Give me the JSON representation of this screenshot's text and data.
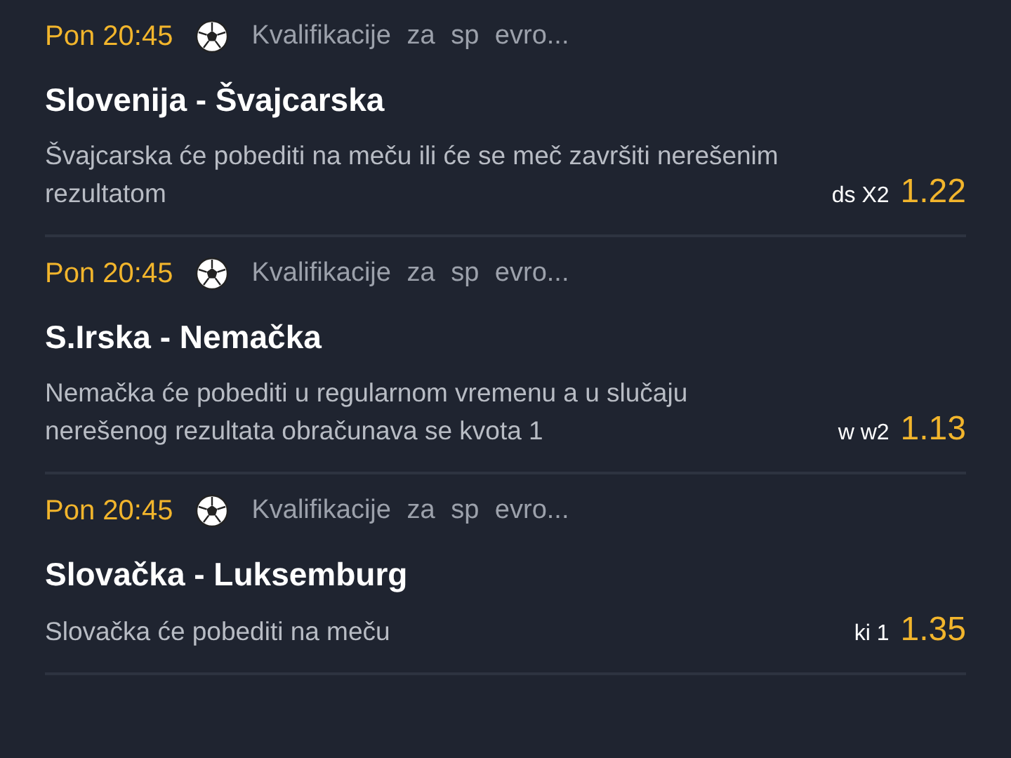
{
  "matches": [
    {
      "time": "Pon 20:45",
      "league": "Kvalifikacije za sp evro...",
      "teams": "Slovenija - Švajcarska",
      "description": "Švajcarska će pobediti na meču ili će se meč završiti nerešenim rezultatom",
      "bet": "ds X2",
      "odds": "1.22"
    },
    {
      "time": "Pon 20:45",
      "league": "Kvalifikacije za sp evro...",
      "teams": "S.Irska - Nemačka",
      "description": "Nemačka će pobediti u regularnom vremenu a u slučaju nerešenog rezultata obračunava se kvota 1",
      "bet": "w w2",
      "odds": "1.13"
    },
    {
      "time": "Pon 20:45",
      "league": "Kvalifikacije za sp evro...",
      "teams": "Slovačka - Luksemburg",
      "description": "Slovačka će pobediti na meču",
      "bet": "ki 1",
      "odds": "1.35"
    }
  ]
}
